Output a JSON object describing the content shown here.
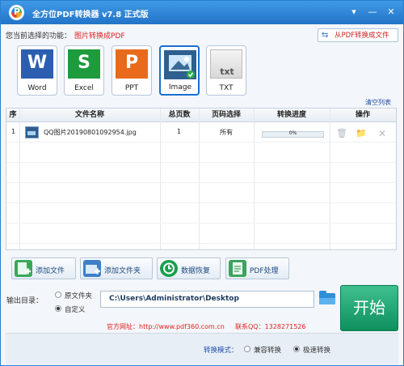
{
  "app": {
    "title": "全方位PDF转换器 v7.8 正式版",
    "window_controls": {
      "menu_icon": "▾",
      "minimize_icon": "—",
      "close_icon": "✕"
    }
  },
  "selector": {
    "label": "您当前选择的功能：",
    "current_function": "图片转换成PDF",
    "from_pdf_button": "从PDF转换成文件",
    "from_pdf_icon": "swap-icon"
  },
  "formats": [
    {
      "name": "Word",
      "letter": "W",
      "color": "#2b5eb0"
    },
    {
      "name": "Excel",
      "letter": "S",
      "color": "#1e9b3c"
    },
    {
      "name": "PPT",
      "letter": "P",
      "color": "#e86a1a"
    },
    {
      "name": "Image",
      "letter": "",
      "color": "#2f5f8f"
    },
    {
      "name": "TXT",
      "letter": "txt",
      "color": "#e6e6e6"
    }
  ],
  "file_list": {
    "clear_label": "清空列表",
    "columns": [
      "序",
      "文件名称",
      "总页数",
      "页码选择",
      "转换进度",
      "操作"
    ],
    "rows": [
      {
        "index": "1",
        "file_name": "QQ图片20190801092954.jpg",
        "total_pages": "1",
        "page_selection": "所有",
        "progress_text": "0%",
        "progress_fraction": 0
      }
    ]
  },
  "actions": [
    {
      "label": "添加文件",
      "icon": "add-file-icon",
      "color": "#3aa85a"
    },
    {
      "label": "添加文件夹",
      "icon": "add-folder-icon",
      "color": "#3d80c9"
    },
    {
      "label": "数据恢复",
      "icon": "restore-icon",
      "color": "#18a04a"
    },
    {
      "label": "PDF处理",
      "icon": "pdf-process-icon",
      "color": "#3ba45e"
    }
  ],
  "output": {
    "label": "输出目录：",
    "option_original": "原文件夹",
    "option_custom": "自定义",
    "selected": "custom",
    "path": "C:\\Users\\Administrator\\Desktop"
  },
  "start_button": "开始",
  "footer": {
    "website": "官方网址：http://www.pdf360.com.cn",
    "qq": "联系QQ：1328271526",
    "mode_label": "转换模式：",
    "mode_compatible": "兼容转换",
    "mode_fast": "极速转换",
    "selected_mode": "fast"
  }
}
